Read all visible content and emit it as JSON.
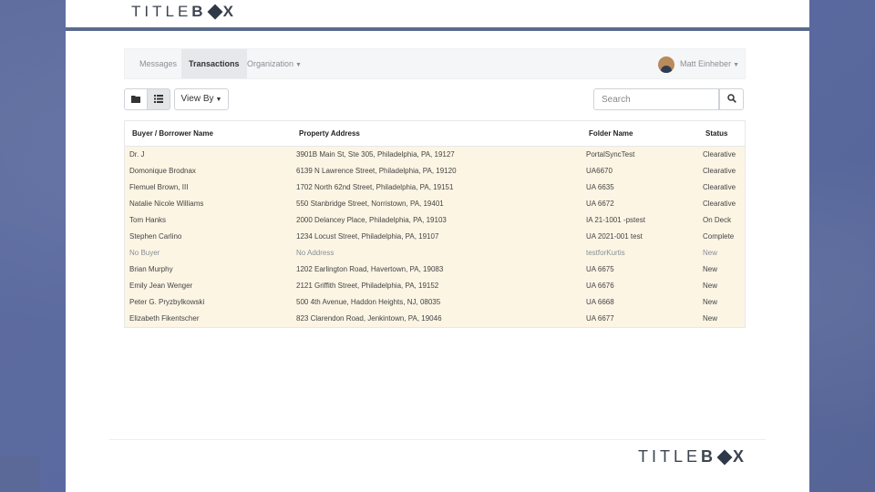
{
  "brand": {
    "logo_prefix": "TITLE",
    "logo_b": "B",
    "logo_suffix": "X"
  },
  "nav": {
    "messages": "Messages",
    "transactions": "Transactions",
    "organization": "Organization",
    "user_name": "Matt Einheber"
  },
  "toolbar": {
    "view_by": "View By",
    "search_placeholder": "Search"
  },
  "table": {
    "headers": [
      "Buyer / Borrower Name",
      "Property Address",
      "Folder Name",
      "Status"
    ],
    "rows": [
      [
        "Dr. J",
        "3901B Main St, Ste 305, Philadelphia, PA, 19127",
        "PortalSyncTest",
        "Clearative"
      ],
      [
        "Domonique Brodnax",
        "6139 N Lawrence Street, Philadelphia, PA, 19120",
        "UA6670",
        "Clearative"
      ],
      [
        "Flemuel Brown, III",
        "1702 North 62nd Street, Philadelphia, PA, 19151",
        "UA 6635",
        "Clearative"
      ],
      [
        "Natalie Nicole Williams",
        "550 Stanbridge Street, Norristown, PA, 19401",
        "UA 6672",
        "Clearative"
      ],
      [
        "Tom Hanks",
        "2000 Delancey Place, Philadelphia, PA, 19103",
        "IA 21-1001 -pstest",
        "On Deck"
      ],
      [
        "Stephen Carlino",
        "1234 Locust Street, Philadelphia, PA, 19107",
        "UA 2021-001 test",
        "Complete"
      ],
      [
        "No Buyer",
        "No Address",
        "testforKurtis",
        "New"
      ],
      [
        "Brian Murphy",
        "1202 Earlington Road, Havertown, PA, 19083",
        "UA 6675",
        "New"
      ],
      [
        "Emily Jean Wenger",
        "2121 Griffith Street, Philadelphia, PA, 19152",
        "UA 6676",
        "New"
      ],
      [
        "Peter G. Pryzbylkowski",
        "500 4th Avenue, Haddon Heights, NJ, 08035",
        "UA 6668",
        "New"
      ],
      [
        "Elizabeth Fikentscher",
        "823 Clarendon Road, Jenkintown, PA, 19046",
        "UA 6677",
        "New"
      ]
    ]
  }
}
